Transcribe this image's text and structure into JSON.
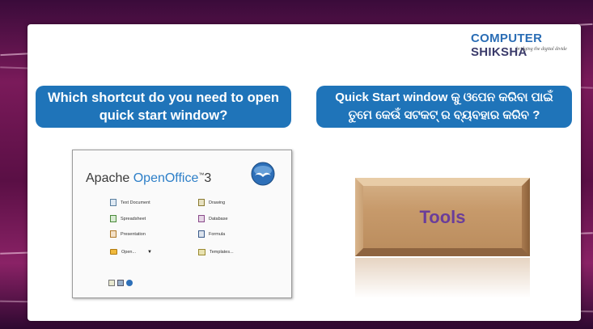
{
  "brand": {
    "name_part1": "COMPUTER",
    "name_part2": " SHIKSHA",
    "tagline": "bridging the digital divide"
  },
  "question_en": {
    "line1": "Which shortcut do you need to open",
    "line2": "quick start window?"
  },
  "question_od": {
    "line1": "Quick Start window କୁ ଓପେନ କରିବା ପାଇଁ",
    "line2": "ତୁମେ କେଉଁ ସଟକଟ୍ ର ବ୍ୟବହାର କରିବ ?"
  },
  "start_center": {
    "title_prefix": "Apache ",
    "title_brand": "OpenOffice",
    "title_tm": "™",
    "title_version": "3",
    "items": [
      {
        "label": "Text Document",
        "icon": "writer-icon"
      },
      {
        "label": "Drawing",
        "icon": "draw-icon"
      },
      {
        "label": "Spreadsheet",
        "icon": "calc-icon"
      },
      {
        "label": "Database",
        "icon": "base-icon"
      },
      {
        "label": "Presentation",
        "icon": "impress-icon"
      },
      {
        "label": "Formula",
        "icon": "math-icon"
      },
      {
        "label": "Open...",
        "icon": "folder-icon"
      },
      {
        "label": "Templates...",
        "icon": "templates-icon"
      }
    ]
  },
  "answer": {
    "label": "Tools"
  },
  "colors": {
    "question_box": "#1f74b9",
    "brand_blue": "#2a6db5",
    "answer_text": "#6a3d9a",
    "wood": "#c79a6b"
  }
}
